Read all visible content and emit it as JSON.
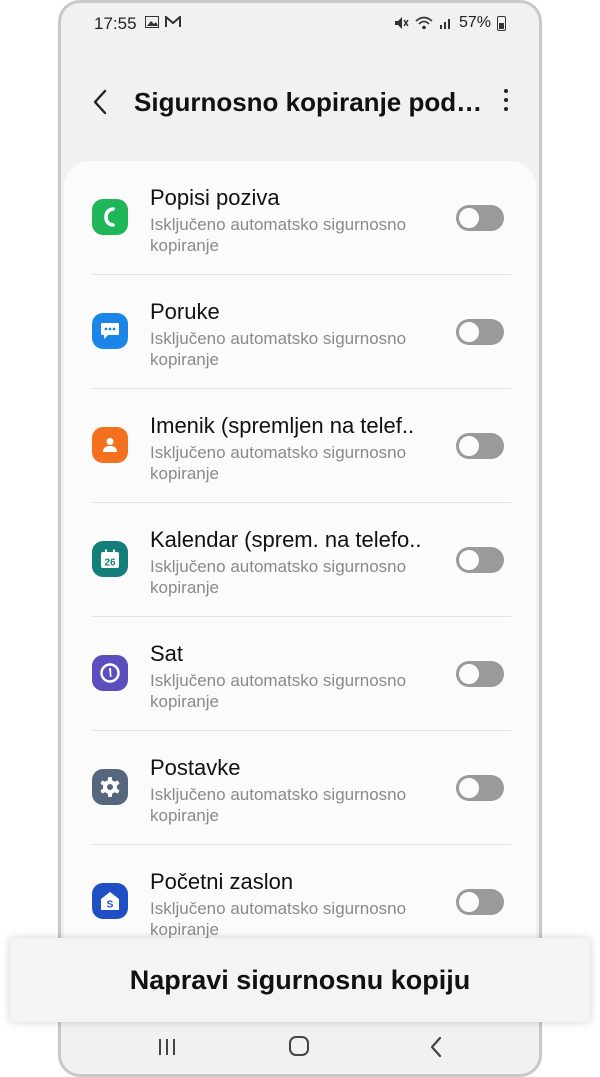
{
  "status": {
    "time": "17:55",
    "battery": "57%"
  },
  "header": {
    "title": "Sigurnosno kopiranje pod…"
  },
  "items": [
    {
      "title": "Popisi poziva",
      "subtitle": "Isključeno automatsko sigurnosno kopiranje",
      "icon": "phone-icon",
      "color": "#1fb65a",
      "enabled": false
    },
    {
      "title": "Poruke",
      "subtitle": "Isključeno automatsko sigurnosno kopiranje",
      "icon": "message-icon",
      "color": "#1c86e8",
      "enabled": false
    },
    {
      "title": "Imenik (spremljen na telef..",
      "subtitle": "Isključeno automatsko sigurnosno kopiranje",
      "icon": "contact-icon",
      "color": "#f2701e",
      "enabled": false
    },
    {
      "title": "Kalendar (sprem. na telefo..",
      "subtitle": "Isključeno automatsko sigurnosno kopiranje",
      "icon": "calendar-icon",
      "icon_text": "26",
      "color": "#147f7a",
      "enabled": false
    },
    {
      "title": "Sat",
      "subtitle": "Isključeno automatsko sigurnosno kopiranje",
      "icon": "clock-icon",
      "color": "#5b4fbd",
      "enabled": false
    },
    {
      "title": "Postavke",
      "subtitle": "Isključeno automatsko sigurnosno kopiranje",
      "icon": "gear-icon",
      "color": "#56677d",
      "enabled": false
    },
    {
      "title": "Početni zaslon",
      "subtitle": "Isključeno automatsko sigurnosno kopiranje",
      "icon": "home-screen-icon",
      "icon_text": "S",
      "color": "#1f4fc4",
      "enabled": false
    }
  ],
  "action": {
    "label": "Napravi sigurnosnu kopiju"
  }
}
